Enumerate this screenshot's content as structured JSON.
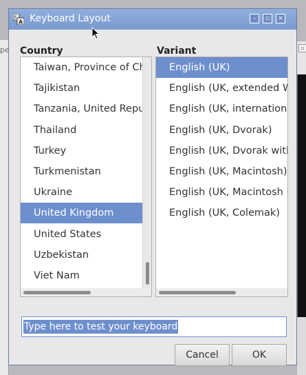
{
  "background": {
    "left_window_label": "pe"
  },
  "window": {
    "title": "Keyboard Layout",
    "controls": {
      "minimize": "–",
      "maximize": "▫",
      "close": "×"
    }
  },
  "country": {
    "header": "Country",
    "items": [
      "Taiwan, Province of Chi",
      "Tajikistan",
      "Tanzania, United Repul",
      "Thailand",
      "Turkey",
      "Turkmenistan",
      "Ukraine",
      "United Kingdom",
      "United States",
      "Uzbekistan",
      "Viet Nam"
    ],
    "selected": "United Kingdom"
  },
  "variant": {
    "header": "Variant",
    "items": [
      "English (UK)",
      "English (UK, extended Wi",
      "English (UK, international",
      "English (UK, Dvorak)",
      "English (UK, Dvorak with",
      "English (UK, Macintosh)",
      "English (UK, Macintosh ir",
      "English (UK, Colemak)"
    ],
    "selected": "English (UK)"
  },
  "test_field": {
    "value": "Type here to test your keyboard"
  },
  "buttons": {
    "cancel": "Cancel",
    "ok": "OK"
  },
  "colors": {
    "titlebar": "#7a9ad0",
    "selection": "#6e8fcd"
  }
}
